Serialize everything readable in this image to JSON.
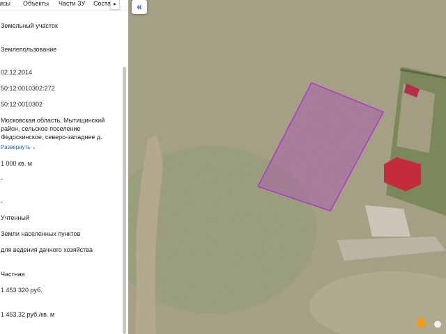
{
  "tabs": [
    "исы",
    "Объекты",
    "Части ЗУ",
    "Соста"
  ],
  "tab_next_icon": "chevron-right-icon",
  "fields": [
    "Земельный участок",
    "Землепользование",
    "02.12.2014",
    "50:12:0010302:272",
    "50:12:0010302",
    "Московская область, Мытищинский район, сельское поселение Федоскинское, северо-западнее д.",
    "1 000 кв. м",
    "-",
    "-",
    "Учтенный",
    "Земли населенных пунктов",
    "для ведения дачного хозяйства",
    "Частная",
    "1 453 320 руб.",
    "1 453,32 руб./кв. м"
  ],
  "expand_link": "Развернуть",
  "collapse_button": "«",
  "map": {
    "parcel_color": "#b03bc4",
    "roof_color": "#c42b3c"
  }
}
